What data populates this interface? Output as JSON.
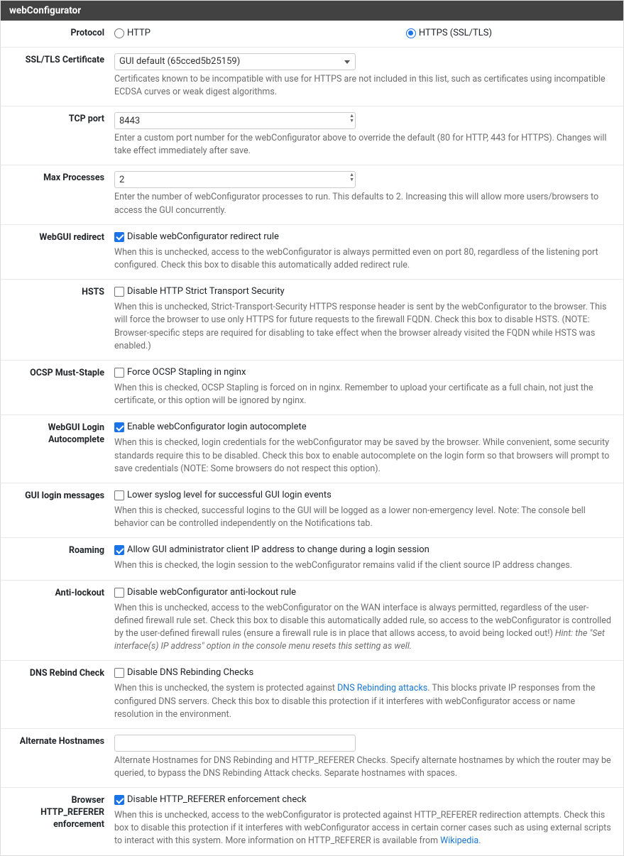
{
  "panel": {
    "title": "webConfigurator"
  },
  "protocol": {
    "label": "Protocol",
    "http": "HTTP",
    "https": "HTTPS (SSL/TLS)",
    "selected": "https"
  },
  "ssl_cert": {
    "label": "SSL/TLS Certificate",
    "value": "GUI default (65cced5b25159)",
    "help": "Certificates known to be incompatible with use for HTTPS are not included in this list, such as certificates using incompatible ECDSA curves or weak digest algorithms."
  },
  "tcp_port": {
    "label": "TCP port",
    "value": "8443",
    "help": "Enter a custom port number for the webConfigurator above to override the default (80 for HTTP, 443 for HTTPS). Changes will take effect immediately after save."
  },
  "max_proc": {
    "label": "Max Processes",
    "value": "2",
    "help": "Enter the number of webConfigurator processes to run. This defaults to 2. Increasing this will allow more users/browsers to access the GUI concurrently."
  },
  "redirect": {
    "label": "WebGUI redirect",
    "check": "Disable webConfigurator redirect rule",
    "help": "When this is unchecked, access to the webConfigurator is always permitted even on port 80, regardless of the listening port configured. Check this box to disable this automatically added redirect rule."
  },
  "hsts": {
    "label": "HSTS",
    "check": "Disable HTTP Strict Transport Security",
    "help": "When this is unchecked, Strict-Transport-Security HTTPS response header is sent by the webConfigurator to the browser. This will force the browser to use only HTTPS for future requests to the firewall FQDN. Check this box to disable HSTS. (NOTE: Browser-specific steps are required for disabling to take effect when the browser already visited the FQDN while HSTS was enabled.)"
  },
  "ocsp": {
    "label": "OCSP Must-Staple",
    "check": "Force OCSP Stapling in nginx",
    "help": "When this is checked, OCSP Stapling is forced on in nginx. Remember to upload your certificate as a full chain, not just the certificate, or this option will be ignored by nginx."
  },
  "autocomplete": {
    "label": "WebGUI Login Autocomplete",
    "check": "Enable webConfigurator login autocomplete",
    "help": "When this is checked, login credentials for the webConfigurator may be saved by the browser. While convenient, some security standards require this to be disabled. Check this box to enable autocomplete on the login form so that browsers will prompt to save credentials (NOTE: Some browsers do not respect this option)."
  },
  "login_msgs": {
    "label": "GUI login messages",
    "check": "Lower syslog level for successful GUI login events",
    "help": "When this is checked, successful logins to the GUI will be logged as a lower non-emergency level. Note: The console bell behavior can be controlled independently on the Notifications tab."
  },
  "roaming": {
    "label": "Roaming",
    "check": "Allow GUI administrator client IP address to change during a login session",
    "help": "When this is checked, the login session to the webConfigurator remains valid if the client source IP address changes."
  },
  "antilockout": {
    "label": "Anti-lockout",
    "check": "Disable webConfigurator anti-lockout rule",
    "help_pre": "When this is unchecked, access to the webConfigurator on the WAN interface is always permitted, regardless of the user-defined firewall rule set. Check this box to disable this automatically added rule, so access to the webConfigurator is controlled by the user-defined firewall rules (ensure a firewall rule is in place that allows access, to avoid being locked out!) ",
    "help_hint": "Hint: the \"Set interface(s) IP address\" option in the console menu resets this setting as well."
  },
  "dns_rebind": {
    "label": "DNS Rebind Check",
    "check": "Disable DNS Rebinding Checks",
    "help_pre": "When this is unchecked, the system is protected against ",
    "help_link": "DNS Rebinding attacks",
    "help_post": ". This blocks private IP responses from the configured DNS servers. Check this box to disable this protection if it interferes with webConfigurator access or name resolution in the environment."
  },
  "alt_hostnames": {
    "label": "Alternate Hostnames",
    "value": "",
    "help": "Alternate Hostnames for DNS Rebinding and HTTP_REFERER Checks. Specify alternate hostnames by which the router may be queried, to bypass the DNS Rebinding Attack checks. Separate hostnames with spaces."
  },
  "http_referer": {
    "label": "Browser HTTP_REFERER enforcement",
    "check": "Disable HTTP_REFERER enforcement check",
    "help_pre": "When this is unchecked, access to the webConfigurator is protected against HTTP_REFERER redirection attempts. Check this box to disable this protection if it interferes with webConfigurator access in certain corner cases such as using external scripts to interact with this system. More information on HTTP_REFERER is available from ",
    "help_link": "Wikipedia",
    "help_post": "."
  }
}
